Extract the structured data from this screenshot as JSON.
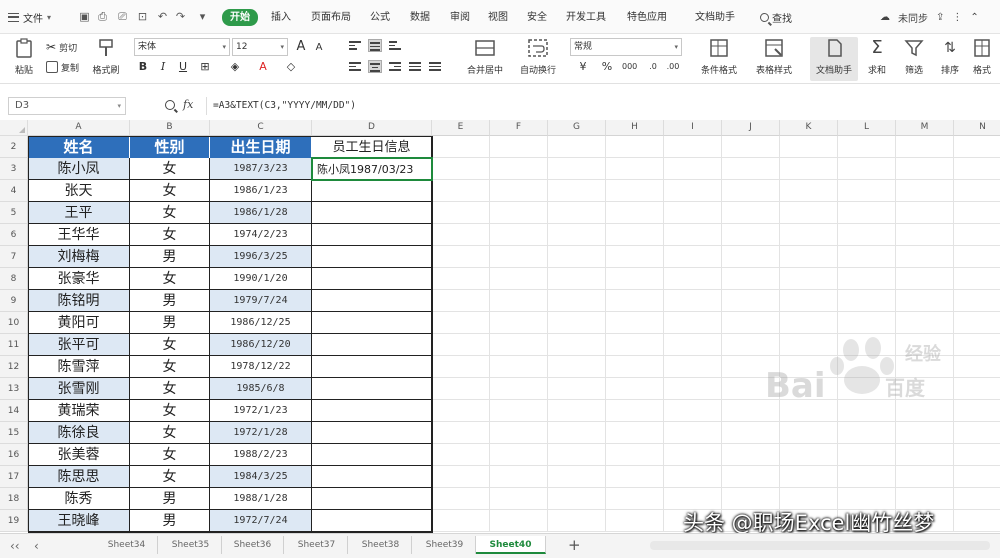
{
  "menubar": {
    "file_label": "文件",
    "tabs": [
      "开始",
      "插入",
      "页面布局",
      "公式",
      "数据",
      "审阅",
      "视图",
      "安全",
      "开发工具",
      "特色应用",
      "文档助手"
    ],
    "active_tab": "开始",
    "search_label": "查找",
    "sync_label": "未同步"
  },
  "ribbon": {
    "paste_label": "粘贴",
    "cut_label": "剪切",
    "copy_label": "复制",
    "format_painter_label": "格式刷",
    "font_name": "宋体",
    "font_size": "12",
    "bold": "B",
    "italic": "I",
    "underline": "U",
    "increase_font": "A",
    "decrease_font": "A",
    "merge_label": "合并居中",
    "wrap_label": "自动换行",
    "number_format": "常规",
    "percent": "%",
    "cond_format_label": "条件格式",
    "table_style_label": "表格样式",
    "docs_label": "文档助手",
    "sum_label": "求和",
    "filter_label": "筛选",
    "sort_label": "排序",
    "format_label": "格式"
  },
  "formula_bar": {
    "cell_ref": "D3",
    "fx": "fx",
    "formula": "=A3&TEXT(C3,\"YYYY/MM/DD\")"
  },
  "columns": [
    "A",
    "B",
    "C",
    "D",
    "E",
    "F",
    "G",
    "H",
    "I",
    "J",
    "K",
    "L",
    "M",
    "N"
  ],
  "rows": [
    "2",
    "3",
    "4",
    "5",
    "6",
    "7",
    "8",
    "9",
    "10",
    "11",
    "12",
    "13",
    "14",
    "15",
    "16",
    "17",
    "18",
    "19"
  ],
  "table": {
    "headers": [
      "姓名",
      "性别",
      "出生日期"
    ],
    "d_header": "员工生日信息",
    "d3_value": "陈小凤1987/03/23",
    "rows": [
      {
        "name": "陈小凤",
        "sex": "女",
        "date": "1987/3/23"
      },
      {
        "name": "张天",
        "sex": "女",
        "date": "1986/1/23"
      },
      {
        "name": "王平",
        "sex": "女",
        "date": "1986/1/28"
      },
      {
        "name": "王华华",
        "sex": "女",
        "date": "1974/2/23"
      },
      {
        "name": "刘梅梅",
        "sex": "男",
        "date": "1996/3/25"
      },
      {
        "name": "张豪华",
        "sex": "女",
        "date": "1990/1/20"
      },
      {
        "name": "陈铭明",
        "sex": "男",
        "date": "1979/7/24"
      },
      {
        "name": "黄阳可",
        "sex": "男",
        "date": "1986/12/25"
      },
      {
        "name": "张平可",
        "sex": "女",
        "date": "1986/12/20"
      },
      {
        "name": "陈雪萍",
        "sex": "女",
        "date": "1978/12/22"
      },
      {
        "name": "张雪刚",
        "sex": "女",
        "date": "1985/6/8"
      },
      {
        "name": "黄瑞荣",
        "sex": "女",
        "date": "1972/1/23"
      },
      {
        "name": "陈徐良",
        "sex": "女",
        "date": "1972/1/28"
      },
      {
        "name": "张美蓉",
        "sex": "女",
        "date": "1988/2/23"
      },
      {
        "name": "陈思思",
        "sex": "女",
        "date": "1984/3/25"
      },
      {
        "name": "陈秀",
        "sex": "男",
        "date": "1988/1/28"
      },
      {
        "name": "王晓峰",
        "sex": "男",
        "date": "1972/7/24"
      }
    ]
  },
  "sheets": [
    "Sheet34",
    "Sheet35",
    "Sheet36",
    "Sheet37",
    "Sheet38",
    "Sheet39",
    "Sheet40"
  ],
  "active_sheet": "Sheet40",
  "watermark": {
    "brand": "Bai",
    "brand_suffix": "百度",
    "sub": "经验"
  },
  "overlay_caption": "头条 @职场Excel幽竹丝梦",
  "colors": {
    "accent": "#2e9a4a",
    "header_blue": "#2e6fbb",
    "row_blue": "#dde8f4",
    "active_border": "#1e8a3c"
  }
}
